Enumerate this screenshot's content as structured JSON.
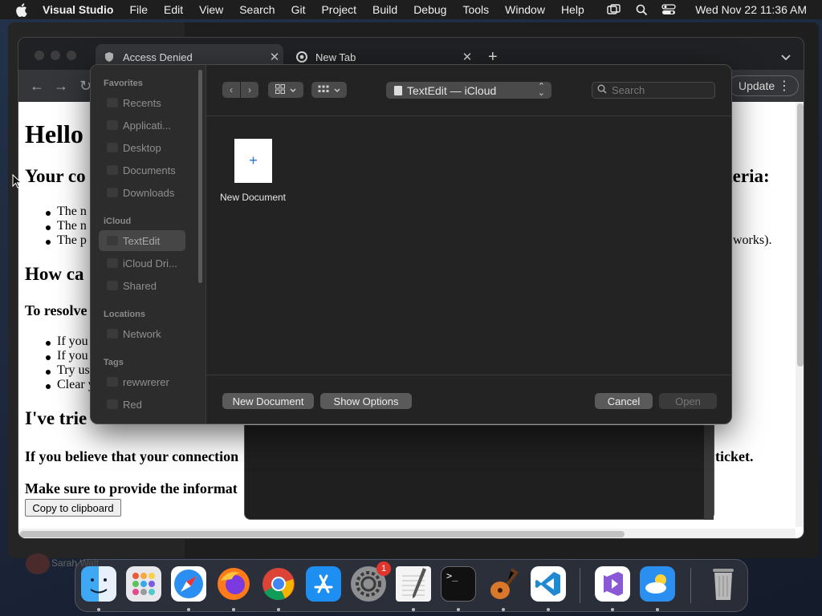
{
  "menubar": {
    "app_name": "Visual Studio",
    "menus": [
      "File",
      "Edit",
      "View",
      "Search",
      "Git",
      "Project",
      "Build",
      "Debug",
      "Tools",
      "Window",
      "Help"
    ],
    "clock": "Wed Nov 22  11:36 AM"
  },
  "browser": {
    "tabs": [
      {
        "title": "Access Denied",
        "icon": "shield-icon"
      },
      {
        "title": "New Tab",
        "icon": "chrome-icon"
      }
    ],
    "update_label": "Update"
  },
  "page": {
    "h1": "Hello",
    "h2a_start": "Your co",
    "h2a_end": "teria:",
    "list1": [
      "The n",
      "The n",
      "The p"
    ],
    "list1_tail": "works).",
    "h2b": "How ca",
    "h3a": "To resolve",
    "list2": [
      "If you",
      "If you",
      "Try us",
      "Clear y"
    ],
    "h2c": "I've trie",
    "h3b": "If you believe that your connection",
    "h3b_tail": "ticket.",
    "h3c": "Make sure to provide the informat",
    "copy_button": "Copy to clipboard"
  },
  "dialog": {
    "sidebar": {
      "favorites_title": "Favorites",
      "favorites": [
        "Recents",
        "Applicati...",
        "Desktop",
        "Documents",
        "Downloads"
      ],
      "icloud_title": "iCloud",
      "icloud": [
        "TextEdit",
        "iCloud Dri...",
        "Shared"
      ],
      "locations_title": "Locations",
      "locations": [
        "Network"
      ],
      "tags_title": "Tags",
      "tags": [
        "rewwrerer",
        "Red"
      ]
    },
    "location": "TextEdit — iCloud",
    "search_placeholder": "Search",
    "new_doc_tile_label": "New Document",
    "footer": {
      "new_document": "New Document",
      "show_options": "Show Options",
      "cancel": "Cancel",
      "open": "Open"
    }
  },
  "background": {
    "strip_label": "Sarah Walt"
  },
  "dock": {
    "apps": [
      "Finder",
      "Launchpad",
      "Safari",
      "Firefox",
      "Google Chrome",
      "App Store",
      "System Settings",
      "TextEdit",
      "Terminal",
      "GarageBand",
      "Visual Studio Code",
      "Visual Studio",
      "Weather",
      "Trash"
    ],
    "settings_badge": "1"
  }
}
